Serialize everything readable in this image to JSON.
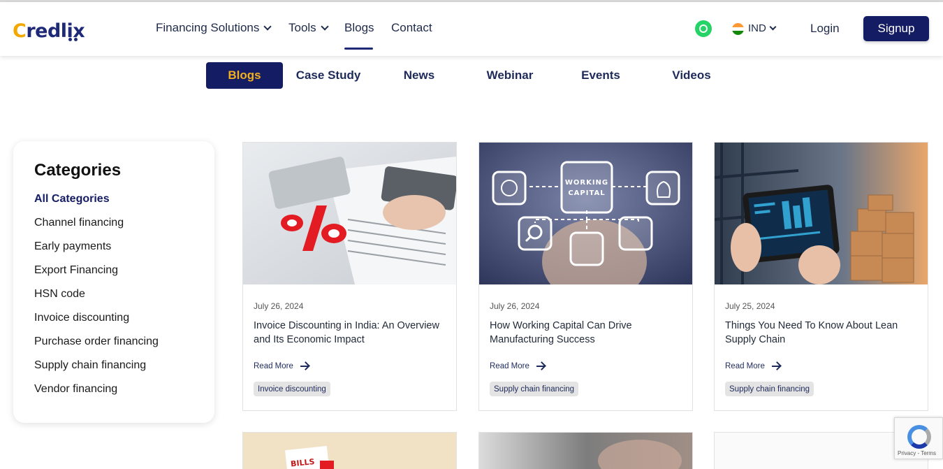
{
  "brand": {
    "logo_c": "C",
    "logo_rest": "redlix"
  },
  "nav": {
    "financing": "Financing Solutions",
    "tools": "Tools",
    "blogs": "Blogs",
    "contact": "Contact",
    "language": "IND",
    "login": "Login",
    "signup": "Signup"
  },
  "tabs": [
    "Blogs",
    "Case Study",
    "News",
    "Webinar",
    "Events",
    "Videos"
  ],
  "sidebar": {
    "title": "Categories",
    "items": [
      "All Categories",
      "Channel financing",
      "Early payments",
      "Export Financing",
      "HSN code",
      "Invoice discounting",
      "Purchase order financing",
      "Supply chain financing",
      "Vendor financing"
    ]
  },
  "cards": [
    {
      "date": "July 26, 2024",
      "title": "Invoice Discounting in India: An Overview and Its Economic Impact",
      "read_more": "Read More",
      "tag": "Invoice discounting"
    },
    {
      "date": "July 26, 2024",
      "title": "How Working Capital Can Drive Manufacturing Success",
      "read_more": "Read More",
      "tag": "Supply chain financing",
      "image_text": {
        "line1": "WORKING",
        "line2": "CAPITAL"
      }
    },
    {
      "date": "July 25, 2024",
      "title": "Things You Need To Know About Lean Supply Chain",
      "read_more": "Read More",
      "tag": "Supply chain financing"
    }
  ],
  "bottom_card": {
    "image_text": "BILLS"
  },
  "recaptcha": {
    "text": "Privacy - Terms"
  },
  "colors": {
    "primary": "#141c64",
    "accent": "#f2b01e",
    "whatsapp": "#25d366"
  }
}
